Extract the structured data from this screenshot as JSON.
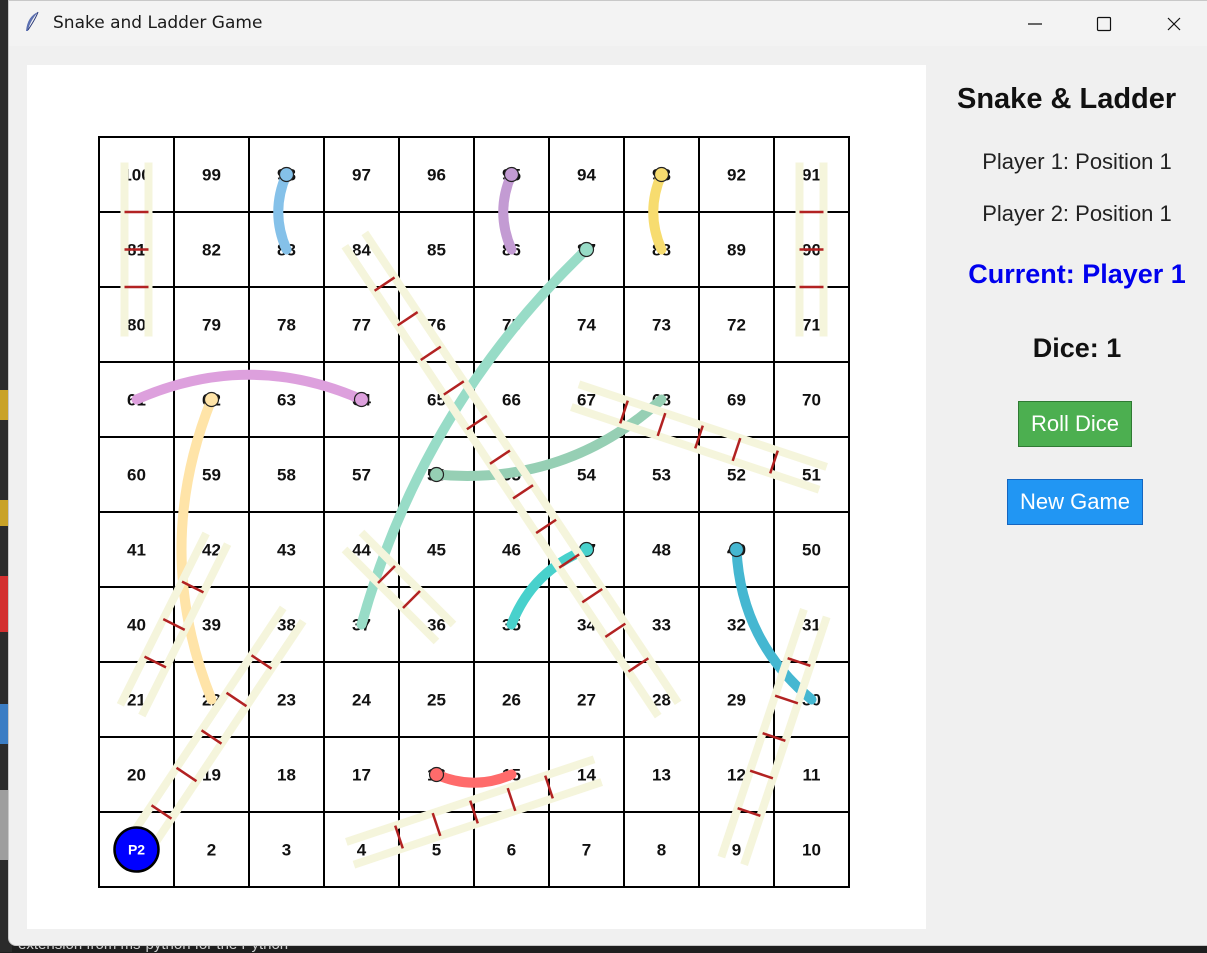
{
  "window": {
    "title": "Snake and Ladder Game"
  },
  "side_panel": {
    "title": "Snake & Ladder",
    "player1_status": "Player 1: Position 1",
    "player2_status": "Player 2: Position 1",
    "current_player": "Current: Player 1",
    "dice": "Dice: 1",
    "roll_button": "Roll Dice",
    "new_game_button": "New Game"
  },
  "board": {
    "rows": [
      [
        100,
        99,
        98,
        97,
        96,
        95,
        94,
        93,
        92,
        91
      ],
      [
        81,
        82,
        83,
        84,
        85,
        86,
        87,
        88,
        89,
        90
      ],
      [
        80,
        79,
        78,
        77,
        76,
        75,
        74,
        73,
        72,
        71
      ],
      [
        61,
        62,
        63,
        64,
        65,
        66,
        67,
        68,
        69,
        70
      ],
      [
        60,
        59,
        58,
        57,
        56,
        55,
        54,
        53,
        52,
        51
      ],
      [
        41,
        42,
        43,
        44,
        45,
        46,
        47,
        48,
        49,
        50
      ],
      [
        40,
        39,
        38,
        37,
        36,
        35,
        34,
        33,
        32,
        31
      ],
      [
        21,
        22,
        23,
        24,
        25,
        26,
        27,
        28,
        29,
        30
      ],
      [
        20,
        19,
        18,
        17,
        16,
        15,
        14,
        13,
        12,
        11
      ],
      [
        1,
        2,
        3,
        4,
        5,
        6,
        7,
        8,
        9,
        10
      ]
    ],
    "snakes": [
      {
        "head": 98,
        "tail": 83,
        "color": "#85c1e9"
      },
      {
        "head": 95,
        "tail": 86,
        "color": "#c39bd3"
      },
      {
        "head": 93,
        "tail": 88,
        "color": "#f7dc6f"
      },
      {
        "head": 87,
        "tail": 37,
        "color": "#98dcc7"
      },
      {
        "head": 64,
        "tail": 61,
        "color": "#dda0dd"
      },
      {
        "head": 62,
        "tail": 22,
        "color": "#ffe4a8"
      },
      {
        "head": 56,
        "tail": 68,
        "color": "#96cfb4"
      },
      {
        "head": 47,
        "tail": 35,
        "color": "#48d1cc"
      },
      {
        "head": 49,
        "tail": 30,
        "color": "#45b7d1"
      },
      {
        "head": 16,
        "tail": 15,
        "color": "#ff6b6b"
      }
    ],
    "ladders": [
      {
        "from": 80,
        "to": 100
      },
      {
        "from": 71,
        "to": 91
      },
      {
        "from": 28,
        "to": 84
      },
      {
        "from": 51,
        "to": 67
      },
      {
        "from": 21,
        "to": 42
      },
      {
        "from": 1,
        "to": 38
      },
      {
        "from": 36,
        "to": 44
      },
      {
        "from": 9,
        "to": 31
      },
      {
        "from": 4,
        "to": 14
      }
    ],
    "tokens": [
      {
        "label": "P2",
        "square": 1,
        "color": "#0000ff"
      }
    ],
    "colors": {
      "ladder_rail": "#f5f5dc",
      "ladder_rung": "#b22222",
      "grid": "#000000"
    }
  },
  "left_edge_text": "extension from ms-python for the Python"
}
